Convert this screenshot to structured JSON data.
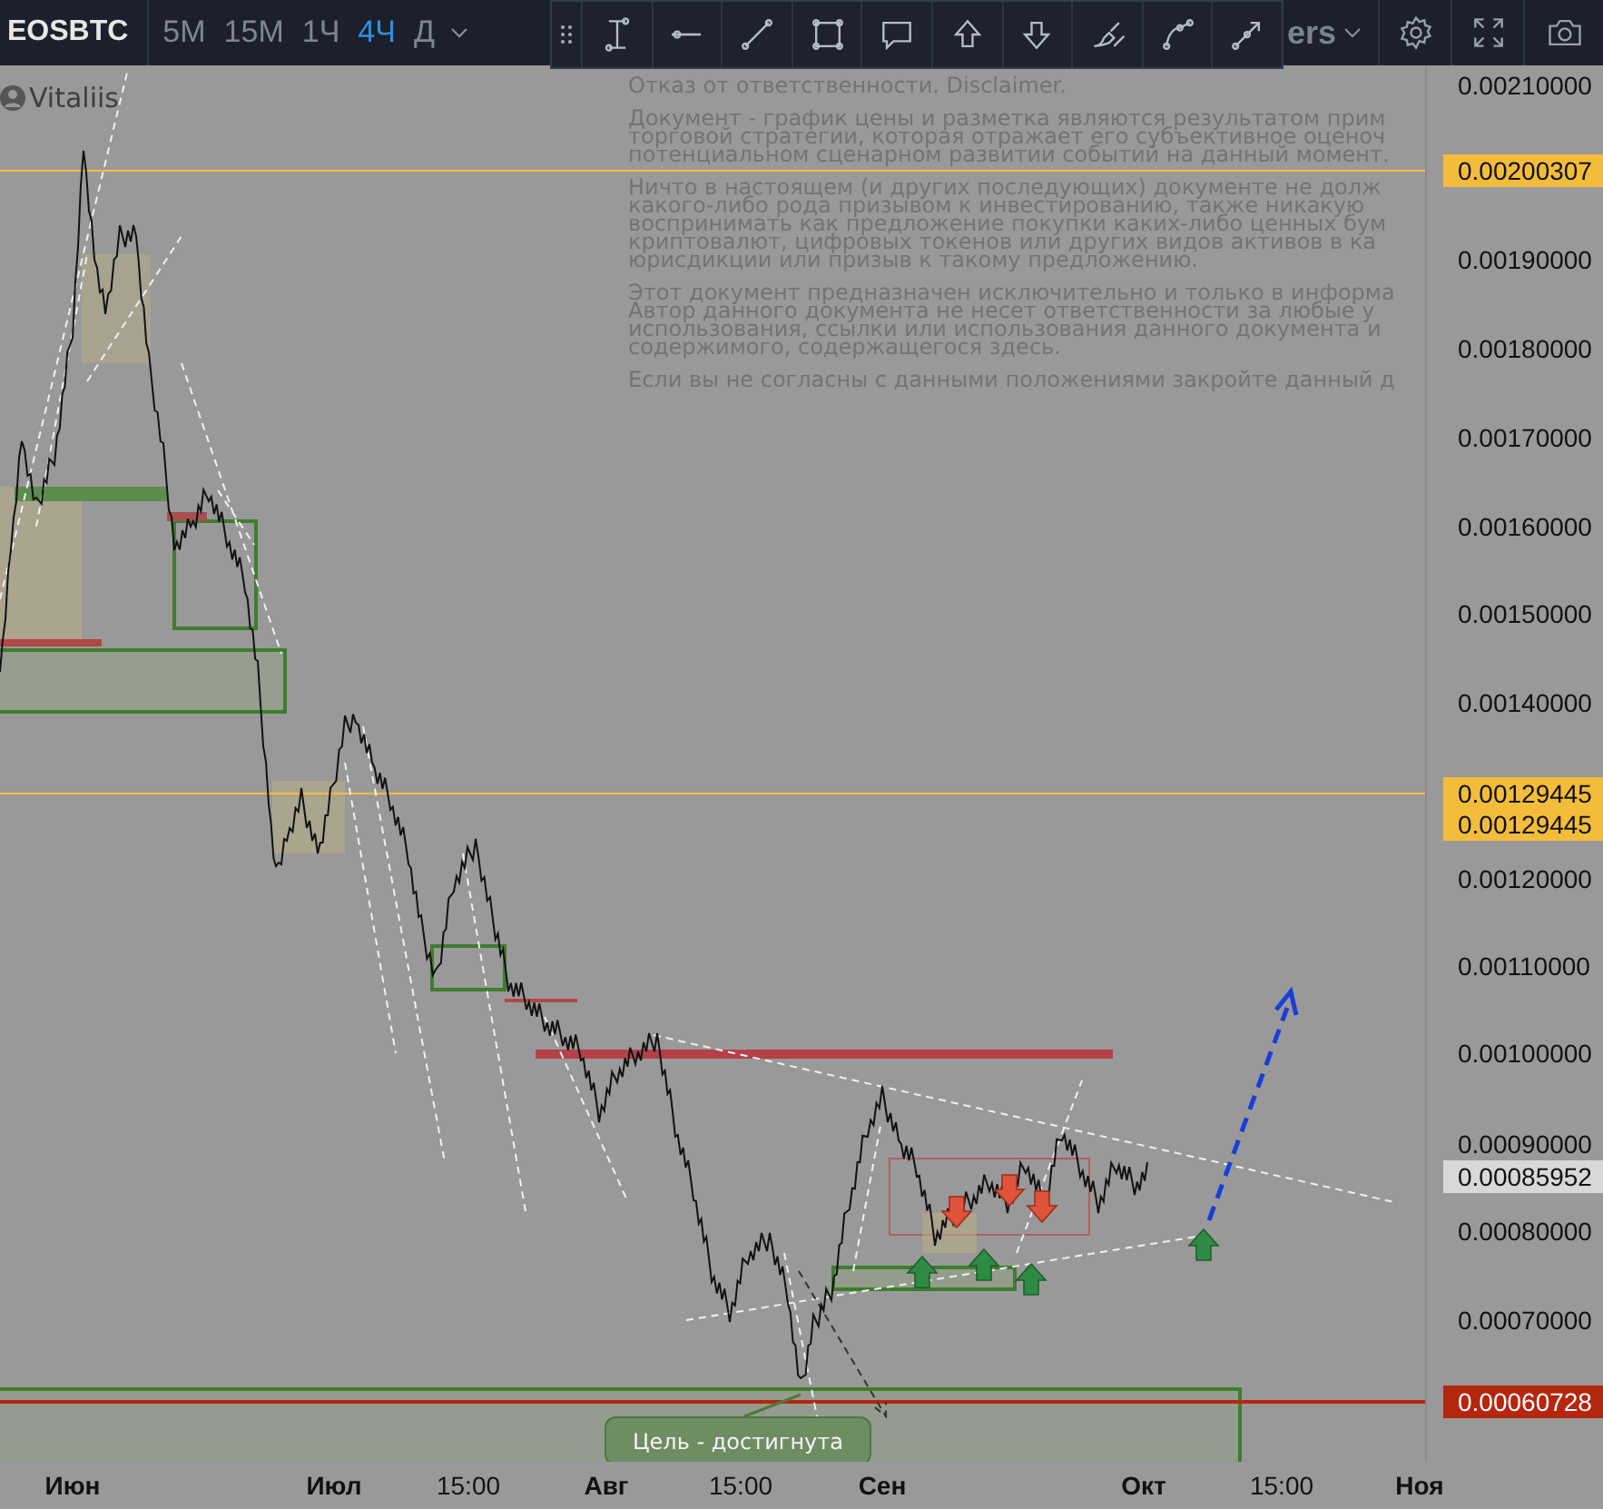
{
  "header": {
    "symbol": "EOSBTC",
    "intervals": [
      {
        "label": "5M",
        "selected": false
      },
      {
        "label": "15M",
        "selected": false
      },
      {
        "label": "1Ч",
        "selected": false
      },
      {
        "label": "4Ч",
        "selected": true
      },
      {
        "label": "Д",
        "selected": false
      }
    ],
    "partial_menu_label": "ers"
  },
  "author": "Vitaliis",
  "disclaimer": [
    [
      "Отказ от ответственности. Disclaimer."
    ],
    [
      "Документ - график цены и разметка являются результатом прим",
      "торговой стратегии, которая отражает его субъективное оценоч",
      "потенциальном сценарном развитии событий на данный момент."
    ],
    [
      "Ничто в настоящем (и других последующих) документе не долж",
      "какого-либо рода призывом к инвестированию, также никакую",
      "воспринимать как предложение покупки каких-либо ценных бум",
      "криптовалют, цифровых токенов или других видов активов в ка",
      "юрисдикции или призыв к такому предложению."
    ],
    [
      "Этот документ предназначен исключительно и только в информа",
      "Автор данного документа не несет ответственности за любые у",
      "использования, ссылки или использования данного документа и",
      "содержимого, содержащегося здесь."
    ],
    [
      "Если вы не согласны с данными положениями закройте данный д"
    ]
  ],
  "callout": "Цель - достигнута",
  "price_axis": {
    "ticks": [
      "0.00210000",
      "0.00190000",
      "0.00180000",
      "0.00170000",
      "0.00160000",
      "0.00150000",
      "0.00140000",
      "0.00120000",
      "0.00110000",
      "0.00100000",
      "0.00090000",
      "0.00080000",
      "0.00070000"
    ],
    "markers": [
      {
        "label": "0.00200307",
        "color": "#f3bd3b"
      },
      {
        "label": "0.00129445",
        "color": "#f3bd3b"
      },
      {
        "label": "0.00129445",
        "color": "#f3bd3b"
      },
      {
        "label": "0.00085952",
        "color": "#d8d8d8"
      },
      {
        "label": "0.00060728",
        "color": "#b5260f"
      }
    ]
  },
  "time_axis": [
    {
      "label": "Июн",
      "kind": "month"
    },
    {
      "label": "Июл",
      "kind": "month"
    },
    {
      "label": "15:00",
      "kind": "time"
    },
    {
      "label": "Авг",
      "kind": "month"
    },
    {
      "label": "15:00",
      "kind": "time"
    },
    {
      "label": "Сен",
      "kind": "month"
    },
    {
      "label": "Окт",
      "kind": "month"
    },
    {
      "label": "15:00",
      "kind": "time"
    },
    {
      "label": "Ноя",
      "kind": "month"
    }
  ]
}
